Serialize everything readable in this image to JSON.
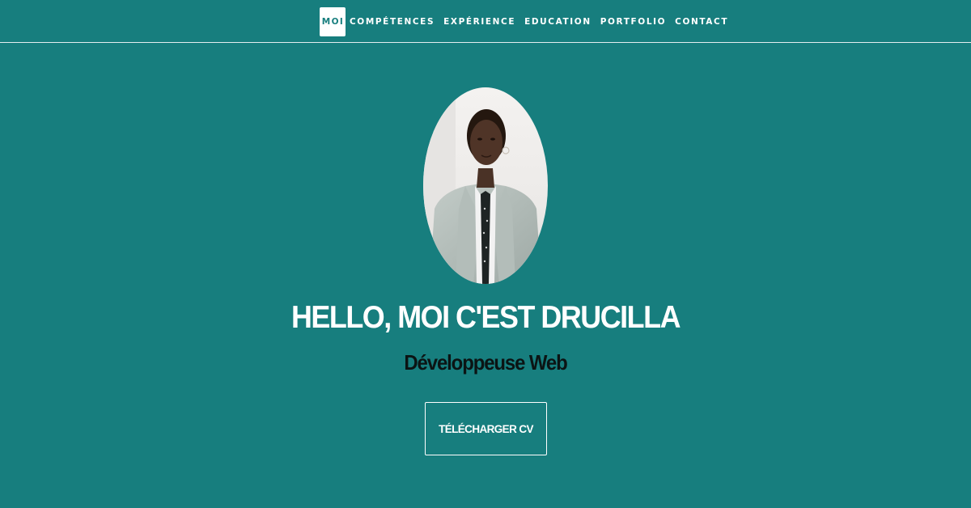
{
  "nav": {
    "items": [
      {
        "label": "MOI",
        "active": true
      },
      {
        "label": "COMPÉTENCES"
      },
      {
        "label": "EXPÉRIENCE"
      },
      {
        "label": "EDUCATION"
      },
      {
        "label": "PORTFOLIO"
      },
      {
        "label": "CONTACT"
      }
    ]
  },
  "hero": {
    "title": "HELLO, MOI C'EST DRUCILLA",
    "subtitle": "Développeuse Web",
    "cv_button_label": "TÉLÉCHARGER CV"
  },
  "colors": {
    "background": "#177e7e",
    "text_light": "#ffffff",
    "text_dark": "#0b1414"
  }
}
